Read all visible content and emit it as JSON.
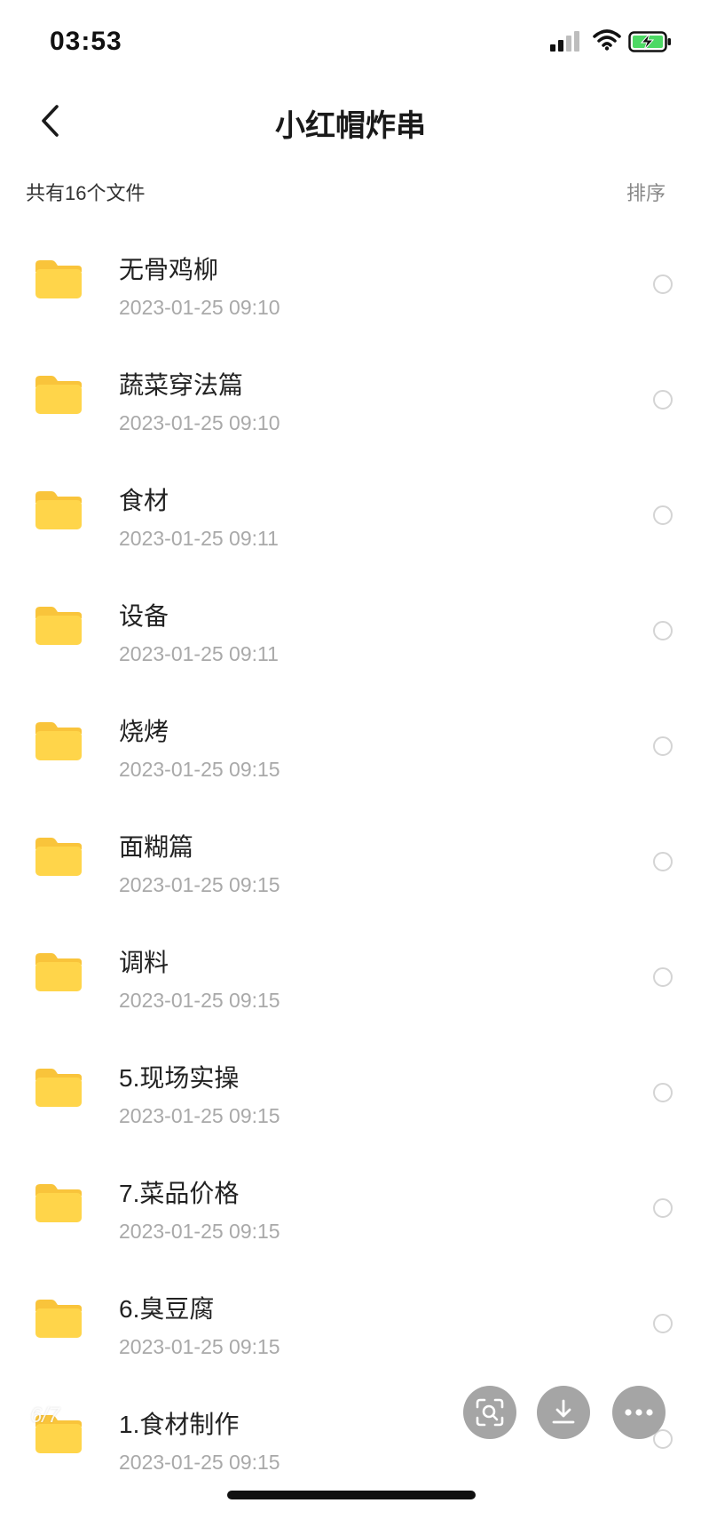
{
  "status_bar": {
    "time": "03:53"
  },
  "header": {
    "title": "小红帽炸串"
  },
  "summary": {
    "count_text": "共有16个文件",
    "sort_label": "排序"
  },
  "files": [
    {
      "name": "无骨鸡柳",
      "date": "2023-01-25 09:10"
    },
    {
      "name": "蔬菜穿法篇",
      "date": "2023-01-25 09:10"
    },
    {
      "name": "食材",
      "date": "2023-01-25 09:11"
    },
    {
      "name": "设备",
      "date": "2023-01-25 09:11"
    },
    {
      "name": "烧烤",
      "date": "2023-01-25 09:15"
    },
    {
      "name": "面糊篇",
      "date": "2023-01-25 09:15"
    },
    {
      "name": "调料",
      "date": "2023-01-25 09:15"
    },
    {
      "name": "5.现场实操",
      "date": "2023-01-25 09:15"
    },
    {
      "name": "7.菜品价格",
      "date": "2023-01-25 09:15"
    },
    {
      "name": "6.臭豆腐",
      "date": "2023-01-25 09:15"
    },
    {
      "name": "1.食材制作",
      "date": "2023-01-25 09:15"
    }
  ],
  "floating_actions": {
    "page_indicator": "6/7",
    "buttons": [
      {
        "icon": "scan-search-icon"
      },
      {
        "icon": "download-icon"
      },
      {
        "icon": "more-icon"
      }
    ]
  },
  "icons": {
    "back": "chevron-left-icon",
    "folder": "folder-icon",
    "select": "radio-circle-icon",
    "signal": "cellular-signal-icon",
    "wifi": "wifi-icon",
    "battery": "battery-charging-icon"
  },
  "colors": {
    "folder": "#FFD54A",
    "folder_tab": "#F9C43B",
    "battery_fill": "#4CD964",
    "date_text": "#A9A9A9",
    "fab_bg": "#8C8C8C"
  }
}
